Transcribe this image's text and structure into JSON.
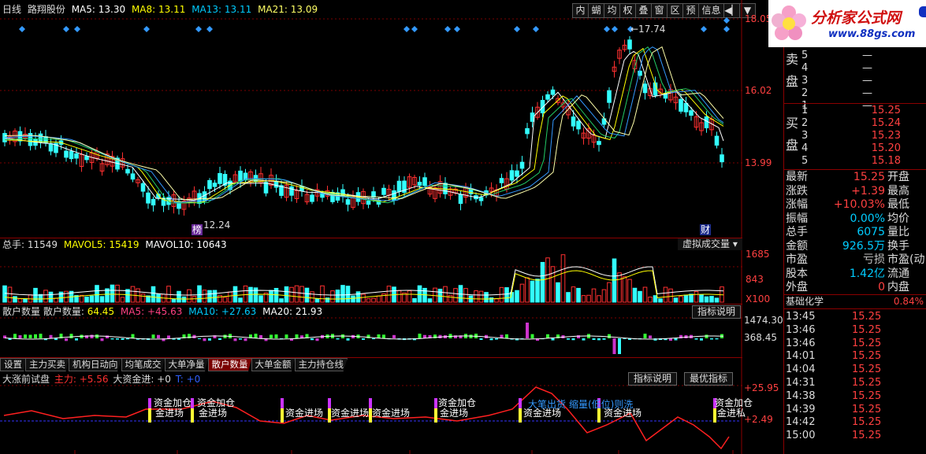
{
  "header": {
    "period": "日线",
    "stock_name": "路翔股份",
    "ma": [
      {
        "label": "MA5: 13.30",
        "color": "#ffffff"
      },
      {
        "label": "MA8: 13.11",
        "color": "#ffff00"
      },
      {
        "label": "MA13: 13.11",
        "color": "#00ccff"
      },
      {
        "label": "MA21: 13.09",
        "color": "#ffff66"
      }
    ]
  },
  "toolbar": [
    "内",
    "蝴",
    "均",
    "权",
    "叠",
    "窗",
    "区",
    "预",
    "信息",
    "◀▏",
    "▼"
  ],
  "price_axis": [
    "18.05",
    "16.02",
    "13.99"
  ],
  "price_annotations": {
    "high": "←17.74",
    "low": "12.24",
    "mark1": "榜",
    "mark2": "财"
  },
  "volume": {
    "title": "总手",
    "value": "11549",
    "mavol5_label": "MAVOL5:",
    "mavol5": "15419",
    "mavol10_label": "MAVOL10:",
    "mavol10": "10643",
    "dropdown": "虚拟成交量",
    "axis": [
      "1685",
      "843",
      "X100"
    ]
  },
  "indicator1": {
    "name": "散户数量",
    "name2": "散户数量:",
    "value": "64.45",
    "ma5": "MA5: +45.63",
    "ma10": "MA10: +27.63",
    "ma20": "MA20: 21.93",
    "button": "指标说明",
    "axis": [
      "1474.30",
      "368.45"
    ]
  },
  "tabs": [
    "设置",
    "主力买卖",
    "机构日动向",
    "均笔成交",
    "大单净量",
    "散户数量",
    "大单金额",
    "主力持仓线"
  ],
  "active_tab": 5,
  "indicator2": {
    "name": "大涨前试盘",
    "main": "主力: +5.56",
    "big": "大资金进: +0",
    "t": "T: +0",
    "button1": "指标说明",
    "button2": "最优指标",
    "axis": [
      "+25.95",
      "+2.49"
    ],
    "labels": [
      "资金加仓",
      "金进场",
      "资金加仓",
      "金进场",
      "资金进场",
      "资金进场",
      "资金进场",
      "资金加仓",
      "金进场",
      "资金加仓",
      "金进场",
      "大笔出货",
      "缩量(低位)则洗",
      "资金进场",
      "资金进场",
      "资金加仓",
      "金进私"
    ]
  },
  "logo": {
    "title": "分析家公式网",
    "url": "www.88gs.com"
  },
  "orderbook": {
    "sell_label": [
      "卖",
      "盘"
    ],
    "buy_label": [
      "买",
      "盘"
    ],
    "sell": [
      {
        "n": "5",
        "price": "—"
      },
      {
        "n": "4",
        "price": "—"
      },
      {
        "n": "3",
        "price": "—"
      },
      {
        "n": "2",
        "price": "—"
      },
      {
        "n": "1",
        "price": "—"
      }
    ],
    "buy": [
      {
        "n": "1",
        "price": "15.25"
      },
      {
        "n": "2",
        "price": "15.24"
      },
      {
        "n": "3",
        "price": "15.23"
      },
      {
        "n": "4",
        "price": "15.20"
      },
      {
        "n": "5",
        "price": "15.18"
      }
    ]
  },
  "quote": [
    {
      "label": "最新",
      "value": "15.25",
      "label2": "开盘",
      "color": "#ff4040"
    },
    {
      "label": "涨跌",
      "value": "+1.39",
      "label2": "最高",
      "color": "#ff4040"
    },
    {
      "label": "涨幅",
      "value": "+10.03%",
      "label2": "最低",
      "color": "#ff4040"
    },
    {
      "label": "振幅",
      "value": "0.00%",
      "label2": "均价",
      "color": "#00ccff"
    },
    {
      "label": "总手",
      "value": "6075",
      "label2": "量比",
      "color": "#00ccff"
    },
    {
      "label": "金额",
      "value": "926.5万",
      "label2": "换手",
      "color": "#00ccff"
    },
    {
      "label": "市盈",
      "value": "亏损",
      "label2": "市盈(动",
      "color": "#c0c0c0"
    },
    {
      "label": "股本",
      "value": "1.42亿",
      "label2": "流通",
      "color": "#00ccff"
    },
    {
      "label": "外盘",
      "value": "0",
      "label2": "内盘",
      "color": "#ff4040"
    }
  ],
  "sector": {
    "name": "基础化学",
    "change": "0.84%"
  },
  "ticks": [
    {
      "time": "13:45",
      "price": "15.25"
    },
    {
      "time": "13:46",
      "price": "15.25"
    },
    {
      "time": "13:46",
      "price": "15.25"
    },
    {
      "time": "14:01",
      "price": "15.25"
    },
    {
      "time": "14:04",
      "price": "15.25"
    },
    {
      "time": "14:31",
      "price": "15.25"
    },
    {
      "time": "14:38",
      "price": "15.25"
    },
    {
      "time": "14:39",
      "price": "15.25"
    },
    {
      "time": "14:42",
      "price": "15.25"
    },
    {
      "time": "15:00",
      "price": "15.25"
    }
  ],
  "colors": {
    "up": "#ff3030",
    "down": "#33ffff",
    "accent_red": "#8b0000"
  }
}
